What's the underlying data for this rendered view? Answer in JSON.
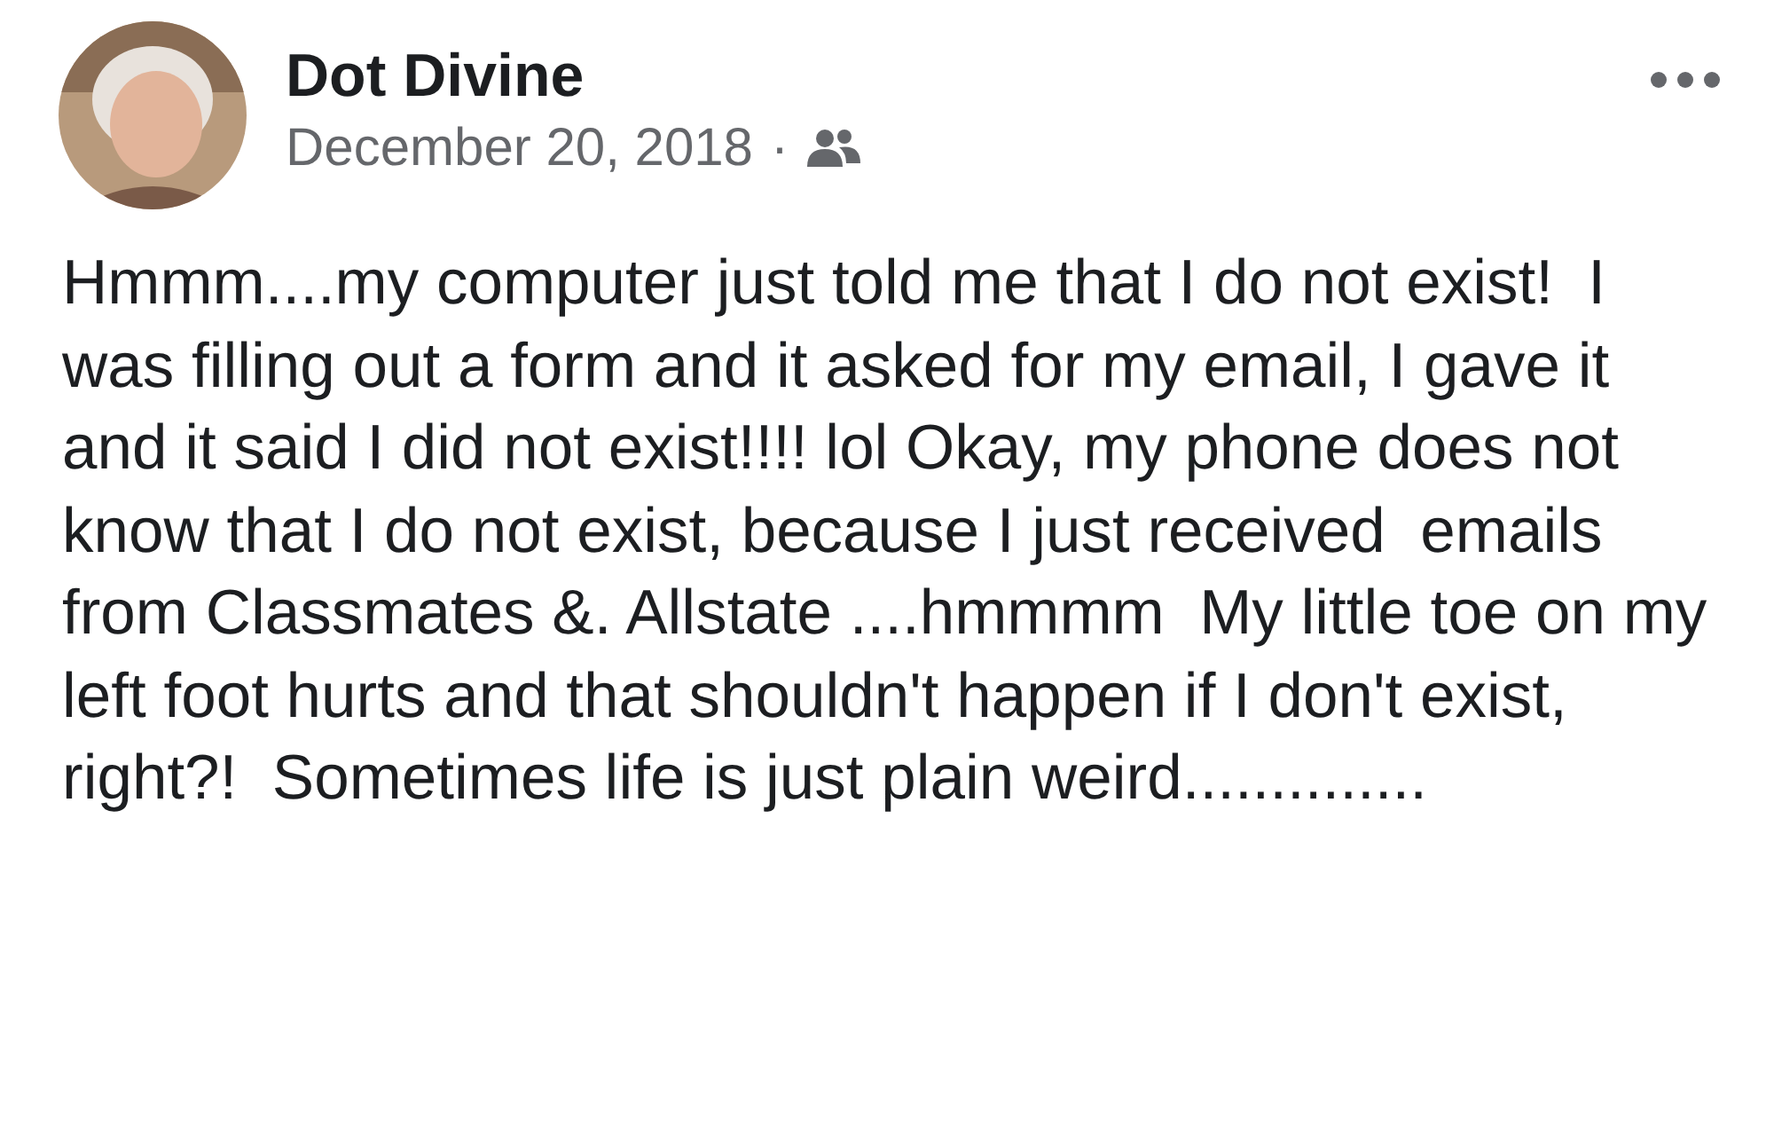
{
  "post": {
    "author": "Dot Divine",
    "date": "December 20, 2018",
    "separator": "·",
    "text": "Hmmm....my computer just told me that I do not exist!  I was filling out a form and it asked for my email, I gave it and it said I did not exist!!!! lol Okay, my phone does not know that I do not exist, because I just received  emails from Classmates &. Allstate ....hmmmm  My little toe on my left foot hurts and that shouldn't happen if I don't exist, right?!  Sometimes life is just plain weird.............."
  }
}
